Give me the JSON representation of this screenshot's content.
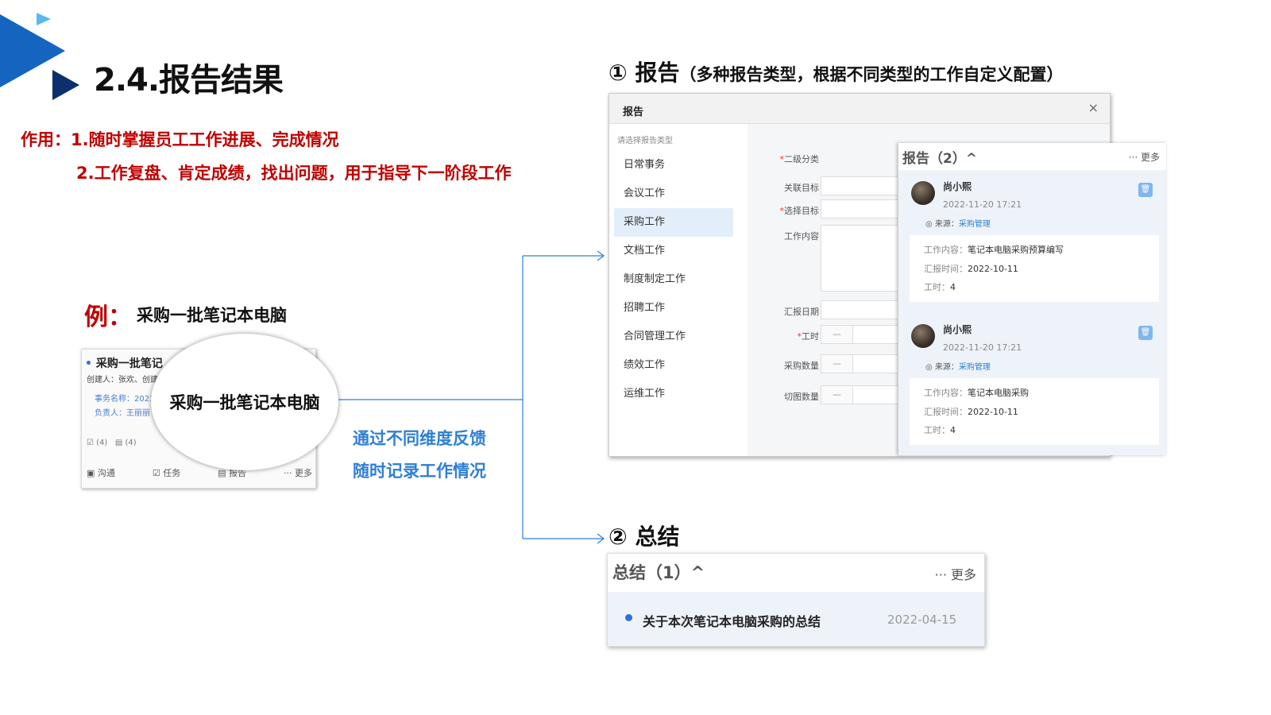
{
  "title": "2.4.报告结果",
  "purpose": {
    "line1": "作用：1.随时掌握员工工作进展、完成情况",
    "line2": "2.工作复盘、肯定成绩，找出问题，用于指导下一阶段工作"
  },
  "example": {
    "label": "例：",
    "text": "采购一批笔记本电脑"
  },
  "mini_card": {
    "title": "采购一批笔记",
    "creator": "创建人：张欢、创建",
    "field_name": "事务名称：2023",
    "field_owner": "负责人：王丽丽",
    "count_a": "(4)",
    "count_b": "(4)",
    "tab_chat": "沟通",
    "tab_task": "任务",
    "tab_report": "报告",
    "tab_more": "··· 更多"
  },
  "magnified_text": "采购一批笔记本电脑",
  "feedback": {
    "line1": "通过不同维度反馈",
    "line2": "随时记录工作情况"
  },
  "report_section": {
    "title": "① 报告",
    "note": "（多种报告类型，根据不同类型的工作自定义配置）"
  },
  "report_dialog": {
    "title": "报告",
    "close": "×",
    "side_label": "请选择报告类型",
    "types": [
      "日常事务",
      "会议工作",
      "采购工作",
      "文档工作",
      "制度制定工作",
      "招聘工作",
      "合同管理工作",
      "绩效工作",
      "运维工作"
    ],
    "active_type": "采购工作",
    "form_labels": {
      "category": "二级分类",
      "related_goal": "关联目标",
      "select_goal": "选择目标",
      "work_content": "工作内容",
      "report_date": "汇报日期",
      "hours": "工时",
      "purchase_qty": "采购数量",
      "cut_qty": "切图数量"
    },
    "dash": "—"
  },
  "report_list": {
    "title": "报告（2）^",
    "more": "··· 更多",
    "items": [
      {
        "name": "尚小熙",
        "time": "2022-11-20 17:21",
        "source_label": "来源：",
        "source_link": "采购管理",
        "content_label": "工作内容：",
        "content": "笔记本电脑采购预算编写",
        "report_time_label": "汇报时间：",
        "report_time": "2022-10-11",
        "hours_label": "工时：",
        "hours": "4"
      },
      {
        "name": "尚小熙",
        "time": "2022-11-20 17:21",
        "source_label": "来源：",
        "source_link": "采购管理",
        "content_label": "工作内容：",
        "content": "笔记本电脑采购",
        "report_time_label": "汇报时间：",
        "report_time": "2022-10-11",
        "hours_label": "工时：",
        "hours": "4"
      }
    ]
  },
  "summary_section": {
    "title": "② 总结"
  },
  "summary_panel": {
    "title": "总结（1）^",
    "more": "··· 更多",
    "item_title": "关于本次笔记本电脑采购的总结",
    "item_date": "2022-04-15"
  },
  "colors": {
    "accent_red": "#c00000",
    "accent_blue": "#2f7fd4",
    "deco_blue": "#1565c0"
  }
}
